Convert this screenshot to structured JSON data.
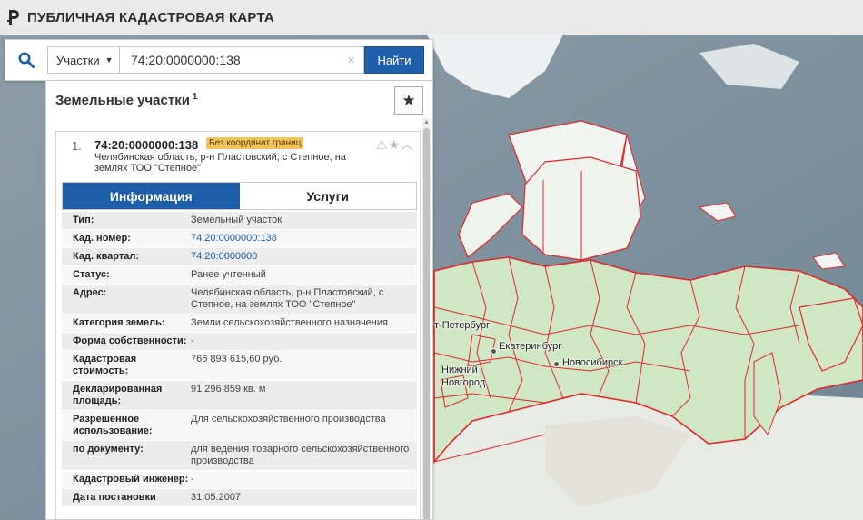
{
  "header": {
    "app_title": "ПУБЛИЧНАЯ КАДАСТРОВАЯ КАРТА",
    "logo_icon": "rosreestr-logo-icon"
  },
  "search": {
    "icon": "search-icon",
    "type_select": "Участки",
    "query": "74:20:0000000:138",
    "clear_symbol": "×",
    "find_label": "Найти"
  },
  "panel": {
    "title": "Земельные участки",
    "count": "1",
    "favorite_icon": "star-icon"
  },
  "result": {
    "index": "1.",
    "cad_number": "74:20:0000000:138",
    "badge": "Без координат границ",
    "address": "Челябинская область, р-н Пластовский, с Степное, на землях ТОО \"Степное\"",
    "icons": [
      "warning-icon",
      "star-icon",
      "chevron-up-icon"
    ]
  },
  "tabs": [
    {
      "label": "Информация",
      "active": true
    },
    {
      "label": "Услуги",
      "active": false
    }
  ],
  "info_rows": [
    {
      "label": "Тип:",
      "value": "Земельный участок",
      "link": false
    },
    {
      "label": "Кад. номер:",
      "value": "74:20:0000000:138",
      "link": true
    },
    {
      "label": "Кад. квартал:",
      "value": "74:20:0000000",
      "link": true
    },
    {
      "label": "Статус:",
      "value": "Ранее учтенный",
      "link": false
    },
    {
      "label": "Адрес:",
      "value": "Челябинская область, р-н Пластовский, с Степное, на землях ТОО \"Степное\"",
      "link": false
    },
    {
      "label": "Категория земель:",
      "value": "Земли сельскохозяйственного назначения",
      "link": false
    },
    {
      "label": "Форма собственности:",
      "value": "-",
      "link": false
    },
    {
      "label": "Кадастровая стоимость:",
      "value": "766 893 615,60 руб.",
      "link": false
    },
    {
      "label": "Декларированная площадь:",
      "value": "91 296 859 кв. м",
      "link": false
    },
    {
      "label": "Разрешенное использование:",
      "value": "Для сельскохозяйственного производства",
      "link": false
    },
    {
      "label": "по документу:",
      "value": "для ведения товарного сельскохозяйственного производства",
      "link": false
    },
    {
      "label": "Кадастровый инженер:",
      "value": "-",
      "link": false
    },
    {
      "label": "Дата постановки",
      "value": "31.05.2007",
      "link": false
    }
  ],
  "map": {
    "cities": [
      "т-Петербург",
      "Екатеринбург",
      "Новосибирск",
      "Нижний",
      "Новгород"
    ],
    "colors": {
      "ocean": "#7c8e9c",
      "land": "#e6ebe4",
      "russia": "#cfe7c2",
      "borders": "#e2262b",
      "arctic": "#f4f6f6"
    }
  }
}
